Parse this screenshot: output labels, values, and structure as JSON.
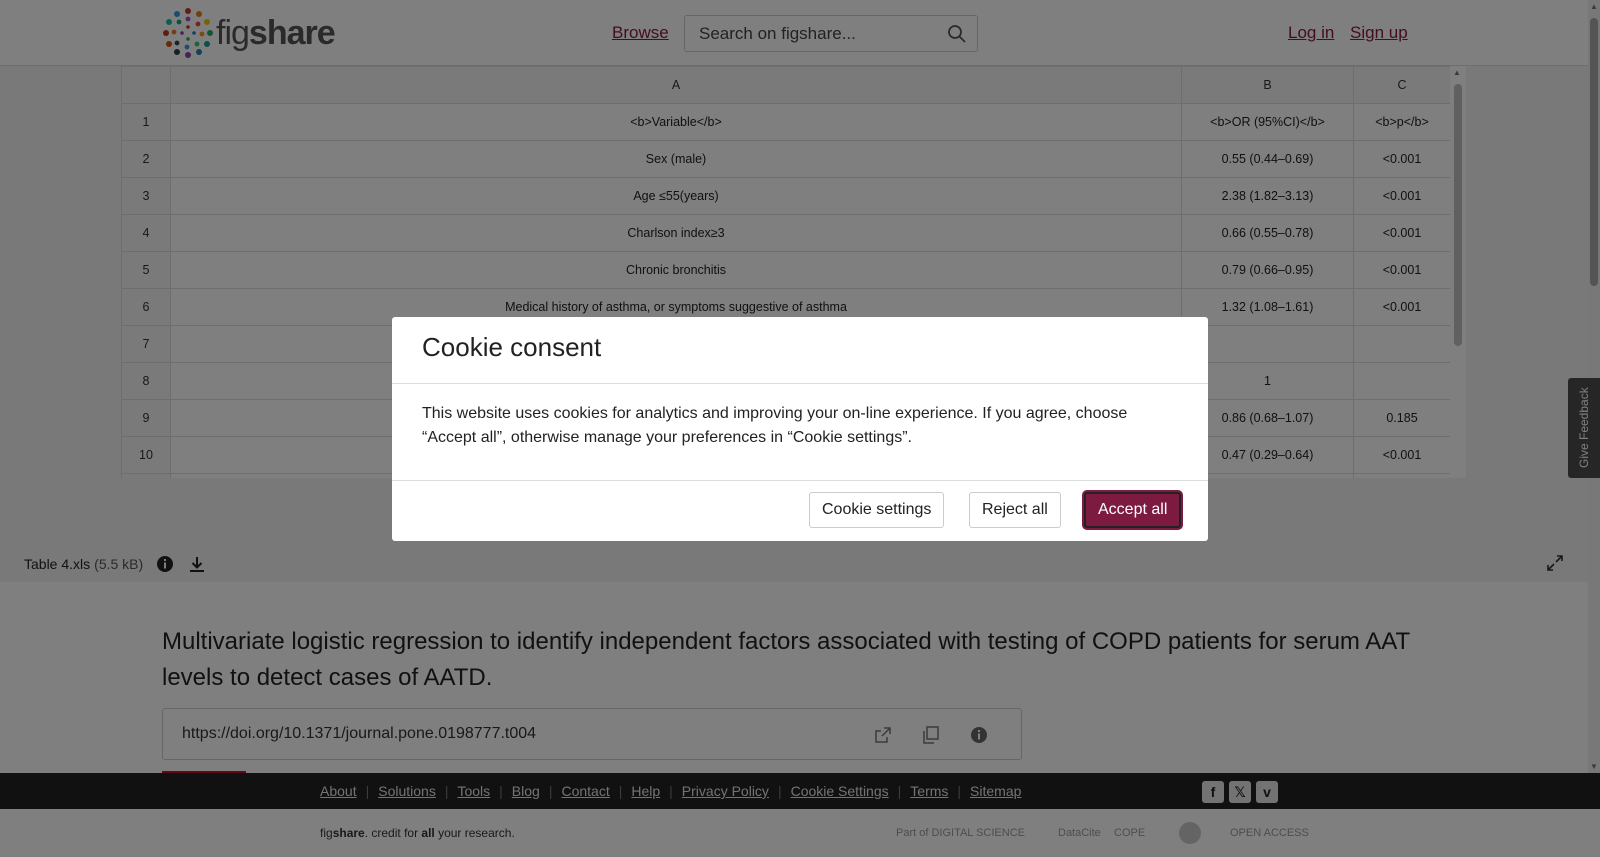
{
  "header": {
    "logo_text_light": "fig",
    "logo_text_bold": "share",
    "browse": "Browse",
    "search_placeholder": "Search on figshare...",
    "login": "Log in",
    "signup": "Sign up"
  },
  "sheet": {
    "columns": [
      "A",
      "B",
      "C"
    ],
    "rows": [
      {
        "n": "1",
        "a": "<b>Variable</b>",
        "b": "<b>OR (95%CI)</b>",
        "c": "<b>p</b>"
      },
      {
        "n": "2",
        "a": "Sex (male)",
        "b": "0.55 (0.44–0.69)",
        "c": "<0.001"
      },
      {
        "n": "3",
        "a": "Age ≤55(years)",
        "b": "2.38 (1.82–3.13)",
        "c": "<0.001"
      },
      {
        "n": "4",
        "a": "Charlson index≥3",
        "b": "0.66 (0.55–0.78)",
        "c": "<0.001"
      },
      {
        "n": "5",
        "a": "Chronic bronchitis",
        "b": "0.79 (0.66–0.95)",
        "c": "<0.001"
      },
      {
        "n": "6",
        "a": "Medical history of asthma, or symptoms suggestive of asthma",
        "b": "1.32 (1.08–1.61)",
        "c": "<0.001"
      },
      {
        "n": "7",
        "a": "",
        "b": "",
        "c": ""
      },
      {
        "n": "8",
        "a": "",
        "b": "1",
        "c": ""
      },
      {
        "n": "9",
        "a": "",
        "b": "0.86 (0.68–1.07)",
        "c": "0.185"
      },
      {
        "n": "10",
        "a": "",
        "b": "0.47 (0.29–0.64)",
        "c": "<0.001"
      },
      {
        "n": "",
        "a": "",
        "b": "",
        "c": ""
      }
    ]
  },
  "file": {
    "name": "Table 4.xls",
    "size": "(5.5 kB)"
  },
  "feedback": "Give Feedback",
  "article": {
    "title": "Multivariate logistic regression to identify independent factors associated with testing of COPD patients for serum AAT levels to detect cases of AATD.",
    "doi": "https://doi.org/10.1371/journal.pone.0198777.t004"
  },
  "footer": {
    "links": [
      "About",
      "Solutions",
      "Tools",
      "Blog",
      "Contact",
      "Help",
      "Privacy Policy",
      "Cookie Settings",
      "Terms",
      "Sitemap"
    ],
    "credit_light": "fig",
    "credit_bold": "share",
    "credit_rest_1": ". credit for ",
    "credit_all": "all",
    "credit_rest_2": " your research.",
    "partners": [
      "Part of DIGITAL SCIENCE",
      "DataCite",
      "COPE",
      "",
      "OPEN ACCESS"
    ]
  },
  "cookie": {
    "title": "Cookie consent",
    "body": "This website uses cookies for analytics and improving your on-line experience. If you agree, choose “Accept all”, otherwise manage your preferences in “Cookie settings”.",
    "settings": "Cookie settings",
    "reject": "Reject all",
    "accept": "Accept all"
  },
  "colors": {
    "brand": "#8a1b3f",
    "accept_button": "#7d1a3f",
    "footer_bg": "#222222"
  }
}
